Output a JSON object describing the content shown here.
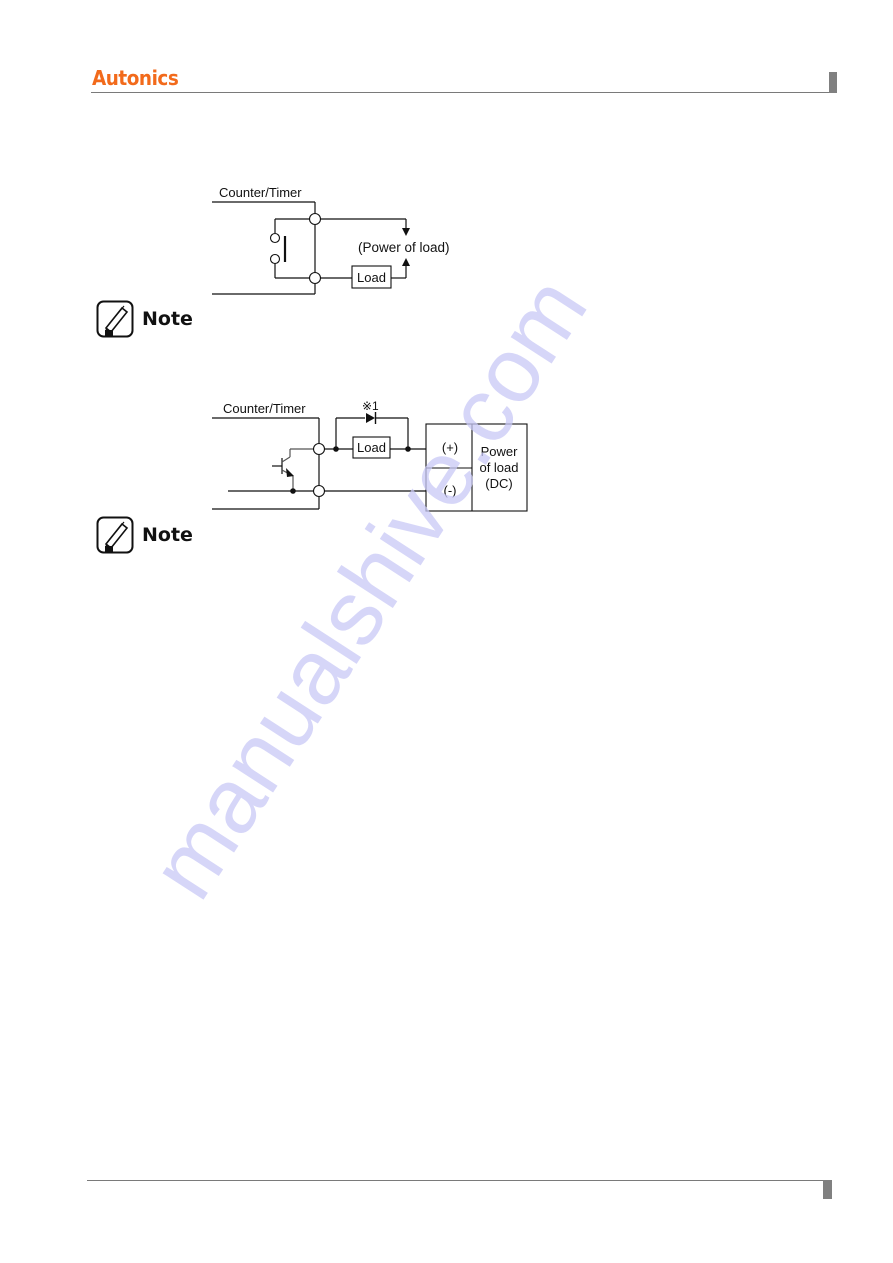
{
  "header": {
    "brand": "Autonics",
    "brand_color": "#f26a1b"
  },
  "diagram_relay": {
    "device_label": "Counter/Timer",
    "load_label": "Load",
    "power_label": "(Power of load)"
  },
  "note_1": {
    "label": "Note",
    "icon": "pencil-note-icon"
  },
  "diagram_transistor": {
    "device_label": "Counter/Timer",
    "diode_marker": "※1",
    "load_label": "Load",
    "plus_label": "(+)",
    "minus_label": "(-)",
    "power_lines": [
      "Power",
      "of load",
      "(DC)"
    ]
  },
  "note_2": {
    "label": "Note",
    "icon": "pencil-note-icon"
  },
  "watermark": {
    "text": "manualshive.com",
    "color": "#c8c8f5"
  }
}
